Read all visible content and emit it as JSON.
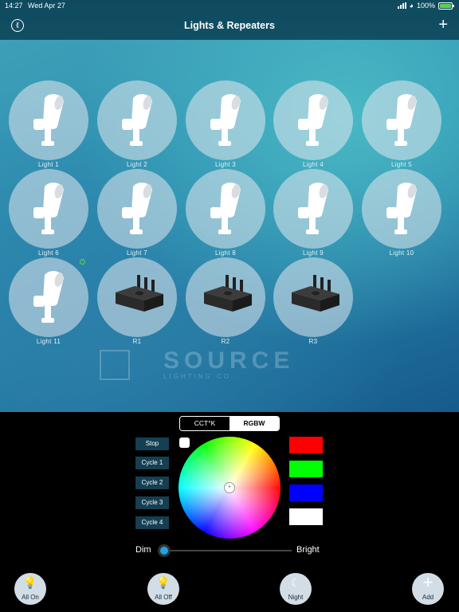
{
  "status_bar": {
    "time": "14:27",
    "date": "Wed Apr 27",
    "battery": "100%",
    "battery_level": 1.0
  },
  "header": {
    "title": "Lights & Repeaters",
    "back_icon": "double-chevron-left-icon",
    "add_icon": "plus-icon"
  },
  "watermark": {
    "brand": "SOURCE",
    "sub": "LIGHTING CO."
  },
  "devices": [
    {
      "label": "Light  1",
      "type": "light"
    },
    {
      "label": "Light  2",
      "type": "light"
    },
    {
      "label": "Light  3",
      "type": "light"
    },
    {
      "label": "Light  4",
      "type": "light"
    },
    {
      "label": "Light  5",
      "type": "light"
    },
    {
      "label": "Light  6",
      "type": "light"
    },
    {
      "label": "Light  7",
      "type": "light"
    },
    {
      "label": "Light  8",
      "type": "light"
    },
    {
      "label": "Light  9",
      "type": "light"
    },
    {
      "label": "Light 10",
      "type": "light"
    },
    {
      "label": "Light 11",
      "type": "light"
    },
    {
      "label": "R1",
      "type": "repeater"
    },
    {
      "label": "R2",
      "type": "repeater"
    },
    {
      "label": "R3",
      "type": "repeater"
    }
  ],
  "mode_tabs": {
    "cct": "CCT°K",
    "rgbw": "RGBW",
    "selected": "RGBW"
  },
  "cycle_buttons": [
    "Stop",
    "Cycle 1",
    "Cycle 2",
    "Cycle 3",
    "Cycle 4"
  ],
  "color_swatches": [
    "#ff0000",
    "#00ff00",
    "#0000ff",
    "#ffffff"
  ],
  "brightness": {
    "dim_label": "Dim",
    "bright_label": "Bright",
    "value": 0.0
  },
  "bottom_bar": {
    "all_on": "All On",
    "all_off": "All Off",
    "night": "Night",
    "add": "Add"
  }
}
